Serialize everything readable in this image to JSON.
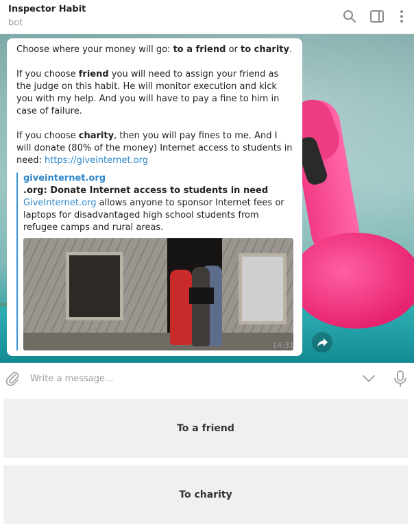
{
  "header": {
    "title": "Inspector Habit",
    "subtitle": "bot"
  },
  "message": {
    "intro": {
      "prefix": "Choose where your money will go: ",
      "opt1": "to a friend",
      "middle": " or ",
      "opt2": "to charity",
      "suffix": "."
    },
    "friend_para": {
      "prefix": "If you choose ",
      "word": "friend",
      "suffix": " you will need to assign your friend as the judge on this habit. He will monitor execution and kick you with my help. And you will have to pay a fine to him in case of failure."
    },
    "charity_para": {
      "prefix": "If you choose ",
      "word": "charity",
      "suffix": ", then you will pay fines to me. And I will donate (80% of the money) Internet access to students in need: "
    },
    "link": "https://giveinternet.org",
    "preview": {
      "site": "giveinternet.org",
      "title": ".org: Donate Internet access to students in need",
      "desc_link": "GiveInternet.org",
      "desc_rest": " allows anyone to sponsor Internet fees or laptops for disadvantaged high school students from refugee camps and rural areas."
    },
    "time": "14:31"
  },
  "composer": {
    "placeholder": "Write a message..."
  },
  "keyboard": {
    "buttons": [
      "To a friend",
      "To charity"
    ]
  },
  "icons": {
    "search": "search-icon",
    "sidebar": "sidebar-toggle-icon",
    "menu": "more-vertical-icon",
    "attach": "paperclip-icon",
    "chevron": "chevron-down-icon",
    "mic": "microphone-icon",
    "share": "share-arrow-icon"
  }
}
